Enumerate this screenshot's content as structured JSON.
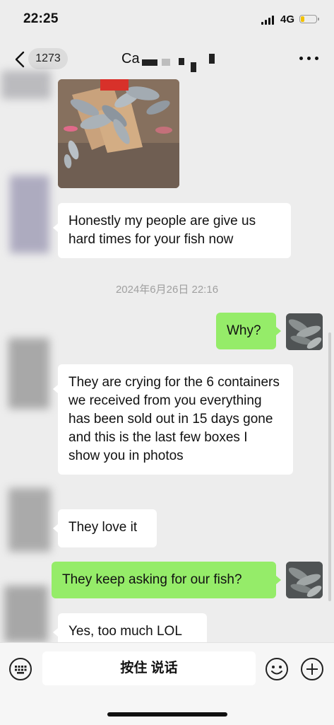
{
  "status_bar": {
    "time": "22:25",
    "network": "4G",
    "battery_level": 0.25,
    "battery_color": "#f2c200"
  },
  "nav": {
    "back_icon": "chevron-left-icon",
    "unread_count": "1273",
    "contact_name_visible": "Ca",
    "more_icon": "ellipsis-icon"
  },
  "messages": [
    {
      "type": "image",
      "direction": "in"
    },
    {
      "type": "text",
      "direction": "in",
      "text": "Honestly my people are give us hard times for your fish now"
    },
    {
      "type": "timestamp",
      "text": "2024年6月26日 22:16"
    },
    {
      "type": "text",
      "direction": "out",
      "text": "Why?"
    },
    {
      "type": "text",
      "direction": "in",
      "text": "They are crying for the 6 containers we received from you everything has been sold out in 15 days gone and this is the last few boxes I show you in photos"
    },
    {
      "type": "text",
      "direction": "in",
      "text": "They love it"
    },
    {
      "type": "text",
      "direction": "out",
      "text": "They keep asking for our fish?"
    },
    {
      "type": "text",
      "direction": "in",
      "text": "Yes, too much LOL"
    }
  ],
  "input_bar": {
    "keyboard_icon": "keyboard-icon",
    "hold_to_talk": "按住 说话",
    "emoji_icon": "emoji-icon",
    "plus_icon": "plus-icon"
  },
  "colors": {
    "background": "#ededed",
    "bubble_in": "#ffffff",
    "bubble_out": "#95ec69"
  }
}
